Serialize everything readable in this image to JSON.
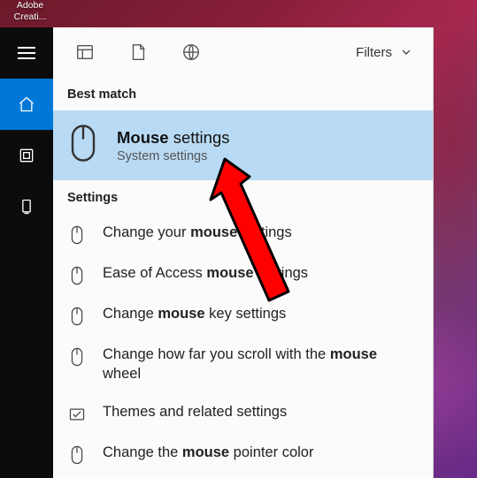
{
  "desktop": {
    "icon_text_l1": "Adobe",
    "icon_text_l2": "Creati..."
  },
  "scope": {
    "filters_label": "Filters"
  },
  "sections": {
    "best_match": "Best match",
    "settings": "Settings"
  },
  "best_match": {
    "title_bold": "Mouse",
    "title_rest": " settings",
    "subtitle": "System settings"
  },
  "results": [
    {
      "pre": "Change your ",
      "bold": "mouse",
      "post": " settings",
      "icon": "mouse"
    },
    {
      "pre": "Ease of Access ",
      "bold": "mouse",
      "post": " settings",
      "icon": "mouse"
    },
    {
      "pre": "Change ",
      "bold": "mouse",
      "post": " key settings",
      "icon": "mouse"
    },
    {
      "pre": "Change how far you scroll with the ",
      "bold": "mouse",
      "post": " wheel",
      "icon": "mouse"
    },
    {
      "pre": "",
      "bold": "",
      "post": "Themes and related settings",
      "icon": "themes"
    },
    {
      "pre": "Change the ",
      "bold": "mouse",
      "post": " pointer color",
      "icon": "mouse"
    }
  ]
}
